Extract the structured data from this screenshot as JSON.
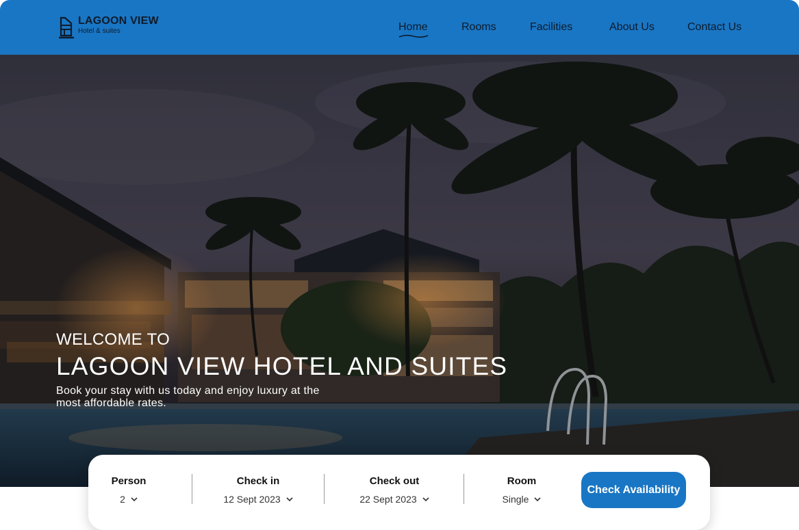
{
  "header": {
    "brand": "LAGOON VIEW",
    "tagline": "Hotel & suites",
    "nav": [
      {
        "label": "Home"
      },
      {
        "label": "Rooms"
      },
      {
        "label": "Facilities"
      },
      {
        "label": "About Us"
      },
      {
        "label": "Contact Us"
      }
    ],
    "active_nav": "Home",
    "colors": {
      "brand_blue": "#1976c4",
      "text_dark": "#0e1b2b"
    }
  },
  "hero": {
    "welcome": "WELCOME TO",
    "title": "LAGOON VIEW HOTEL AND SUITES",
    "subtitle": "Book your stay with us today and enjoy luxury at the most affordable rates."
  },
  "booking": {
    "person": {
      "label": "Person",
      "value": "2"
    },
    "check_in": {
      "label": "Check in",
      "value": "12 Sept 2023"
    },
    "check_out": {
      "label": "Check out",
      "value": "22 Sept 2023"
    },
    "room": {
      "label": "Room",
      "value": "Single"
    },
    "button": "Check Availability"
  },
  "icons": {
    "logo": "hotel-building-icon",
    "dropdown": "chevron-down-icon"
  }
}
